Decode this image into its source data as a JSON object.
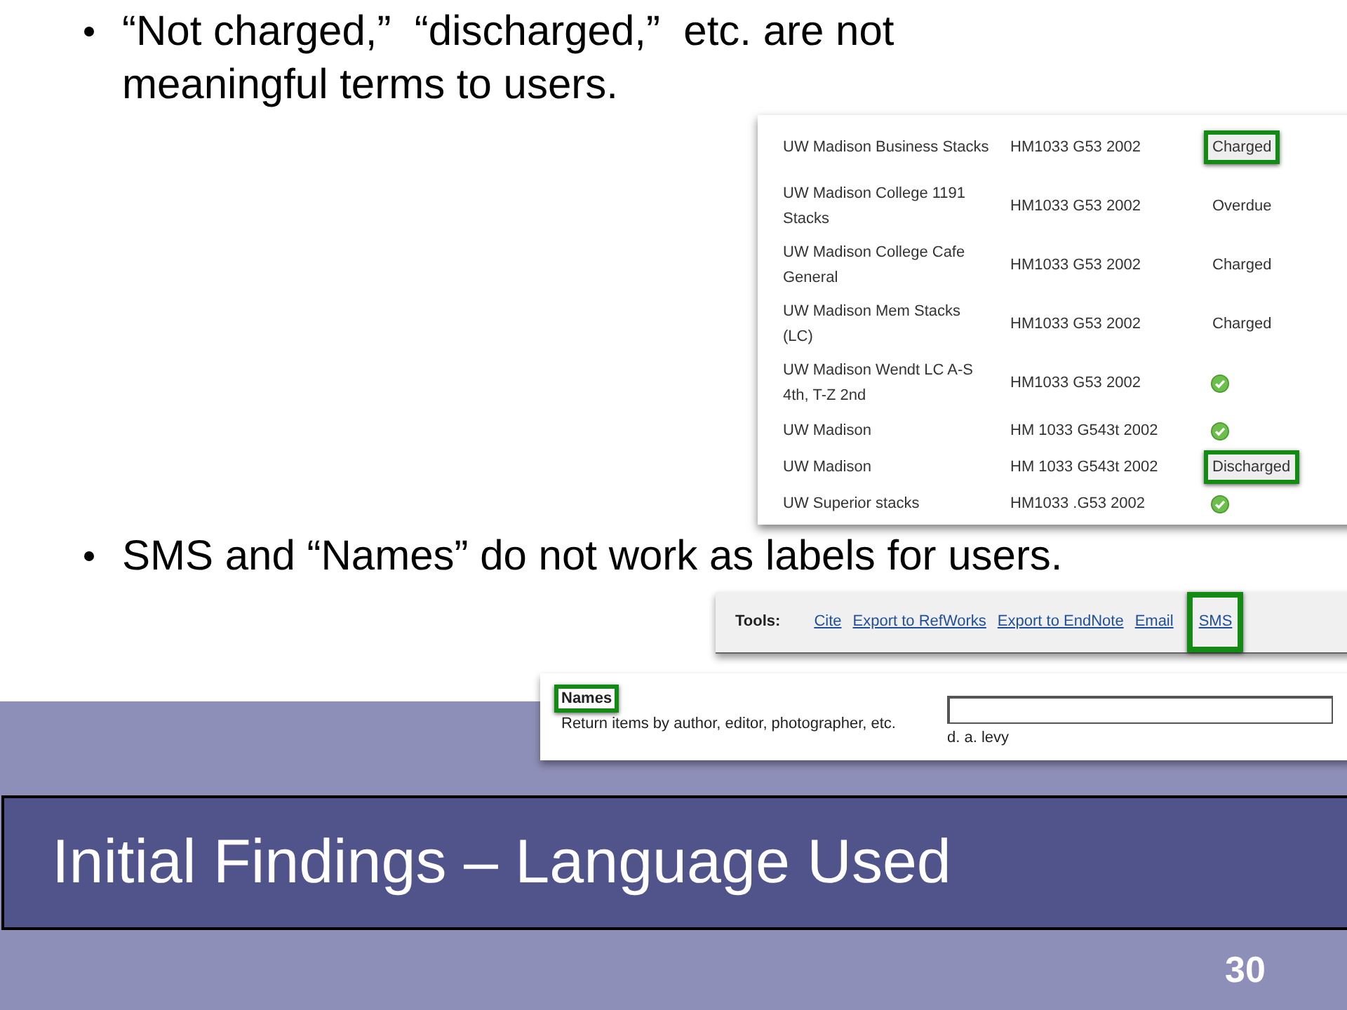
{
  "bullets": [
    {
      "text": "“Not charged,”  “discharged,”  etc. are not meaningful terms to users."
    },
    {
      "text": "SMS and “Names” do not work as labels for users."
    }
  ],
  "holdings": {
    "rows": [
      {
        "location": "UW Madison Business Stacks",
        "call_number": "HM1033 G53 2002",
        "status": {
          "kind": "text",
          "text": "Charged",
          "highlighted": true
        }
      },
      {
        "location": "UW Madison College 1191 Stacks",
        "call_number": "HM1033 G53 2002",
        "status": {
          "kind": "text",
          "text": "Overdue",
          "highlighted": false
        }
      },
      {
        "location": "UW Madison College Cafe General",
        "call_number": "HM1033 G53 2002",
        "status": {
          "kind": "text",
          "text": "Charged",
          "highlighted": false
        }
      },
      {
        "location": "UW Madison Mem Stacks (LC)",
        "call_number": "HM1033 G53 2002",
        "status": {
          "kind": "text",
          "text": "Charged",
          "highlighted": false
        }
      },
      {
        "location": "UW Madison Wendt LC A-S 4th, T-Z 2nd",
        "call_number": "HM1033 G53 2002",
        "status": {
          "kind": "check",
          "highlighted": false
        }
      },
      {
        "location": "UW Madison",
        "call_number": "HM 1033 G543t 2002",
        "status": {
          "kind": "check",
          "highlighted": false
        }
      },
      {
        "location": "UW Madison",
        "call_number": "HM 1033 G543t 2002",
        "status": {
          "kind": "text",
          "text": "Discharged",
          "highlighted": true
        }
      },
      {
        "location": "UW Superior stacks",
        "call_number": "HM1033 .G53 2002",
        "status": {
          "kind": "check",
          "highlighted": false
        }
      }
    ]
  },
  "tools": {
    "label": "Tools:",
    "links": [
      {
        "text": "Cite",
        "highlighted": false
      },
      {
        "text": "Export to RefWorks",
        "highlighted": false
      },
      {
        "text": "Export to EndNote",
        "highlighted": false
      },
      {
        "text": "Email",
        "highlighted": false
      },
      {
        "text": "SMS",
        "highlighted": true
      }
    ]
  },
  "names_field": {
    "label": "Names",
    "label_highlighted": true,
    "description": "Return items by author, editor, photographer, etc.",
    "example": "d. a. levy"
  },
  "title": "Initial Findings – Language Used",
  "slide_number": "30"
}
